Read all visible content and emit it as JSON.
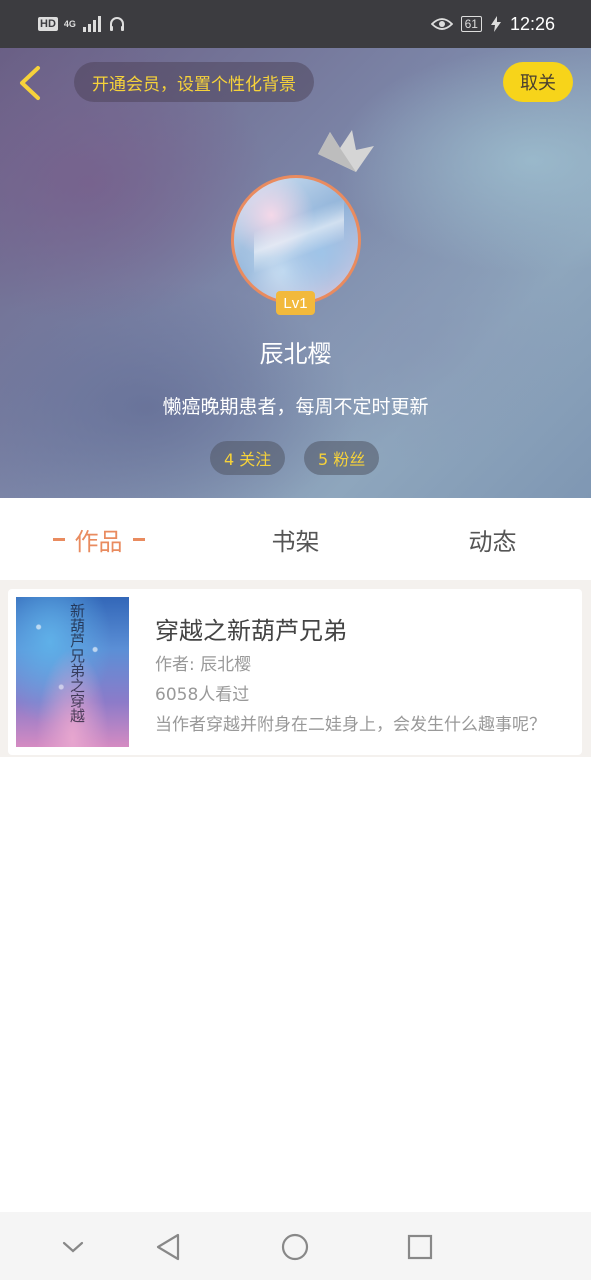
{
  "status_bar": {
    "hd": "HD",
    "network": "4G",
    "battery": "61",
    "time": "12:26",
    "icons": [
      "hd-icon",
      "signal-icon",
      "headphones-icon",
      "eye-icon",
      "battery-icon",
      "charging-icon"
    ]
  },
  "header": {
    "back_icon": "chevron-left-icon",
    "vip_banner": "开通会员，设置个性化背景",
    "follow_button": "取关",
    "crown_icon": "crown-icon",
    "level": "Lv1",
    "username": "辰北樱",
    "bio": "懒癌晚期患者，每周不定时更新",
    "following": "4 关注",
    "fans": "5 粉丝",
    "accent_color": "#f6d23a",
    "follow_button_color": "#f7d41a"
  },
  "tabs": [
    {
      "label": "作品",
      "active": true
    },
    {
      "label": "书架",
      "active": false
    },
    {
      "label": "动态",
      "active": false
    }
  ],
  "tab_active_color": "#e98b5f",
  "books": [
    {
      "cover_text": "新葫芦兄弟之穿越",
      "title": "穿越之新葫芦兄弟",
      "author": "作者: 辰北樱",
      "views": "6058人看过",
      "description": "当作者穿越并附身在二娃身上，会发生什么趣事呢？"
    }
  ],
  "nav_bar": {
    "icons": [
      "collapse-down-icon",
      "back-triangle-icon",
      "home-circle-icon",
      "recents-square-icon"
    ]
  }
}
